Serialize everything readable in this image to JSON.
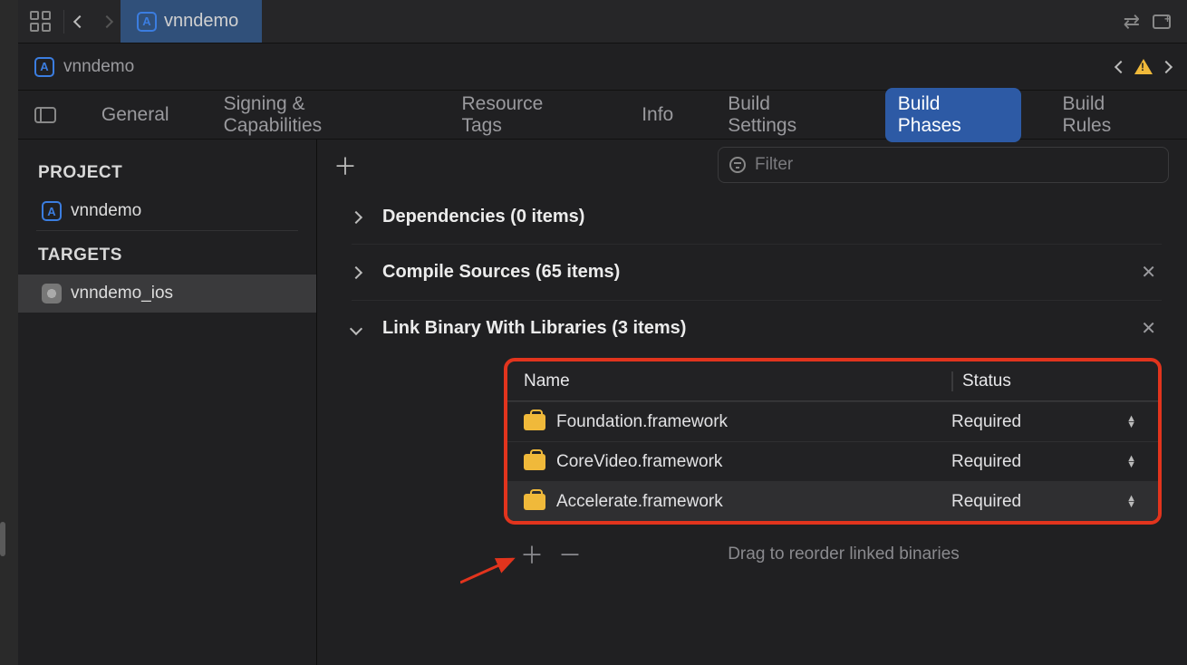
{
  "tabbar": {
    "active_tab_title": "vnndemo"
  },
  "breadcrumb": {
    "title": "vnndemo"
  },
  "editor_tabs": {
    "items": [
      "General",
      "Signing & Capabilities",
      "Resource Tags",
      "Info",
      "Build Settings",
      "Build Phases",
      "Build Rules"
    ],
    "active_index": 5
  },
  "sidebar": {
    "project_heading": "PROJECT",
    "project_name": "vnndemo",
    "targets_heading": "TARGETS",
    "target_name": "vnndemo_ios"
  },
  "filter": {
    "placeholder": "Filter"
  },
  "phases": {
    "dependencies": {
      "title": "Dependencies (0 items)"
    },
    "compile_sources": {
      "title": "Compile Sources (65 items)"
    },
    "link_libs": {
      "title": "Link Binary With Libraries (3 items)",
      "columns": {
        "name": "Name",
        "status": "Status"
      },
      "rows": [
        {
          "name": "Foundation.framework",
          "status": "Required"
        },
        {
          "name": "CoreVideo.framework",
          "status": "Required"
        },
        {
          "name": "Accelerate.framework",
          "status": "Required"
        }
      ],
      "hint": "Drag to reorder linked binaries"
    }
  }
}
